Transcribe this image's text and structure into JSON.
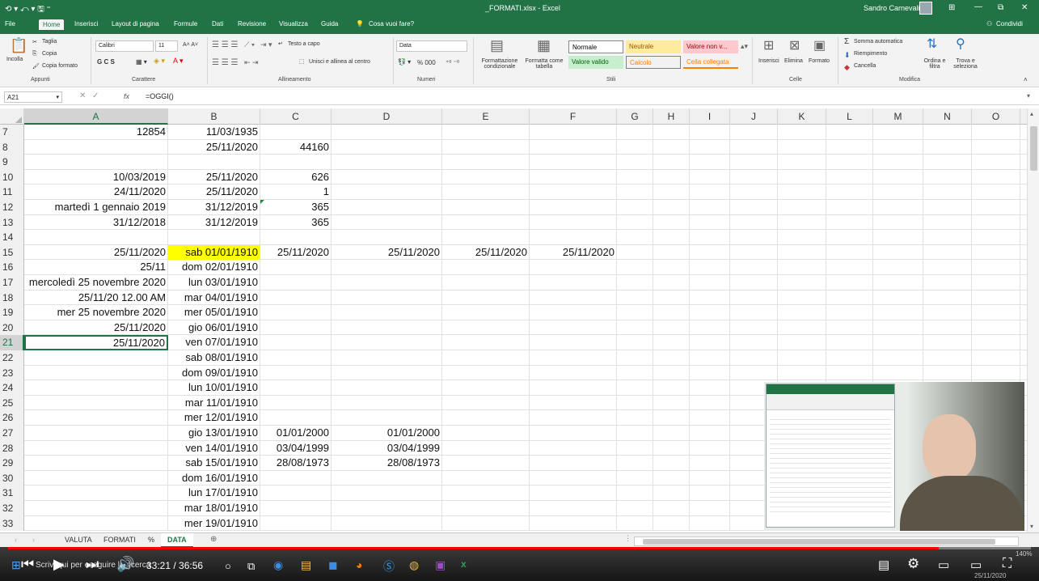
{
  "title": {
    "qat": "⟲ ▾ ⤺ ▾ 🖫 ⁼",
    "filename": "_FORMATI.xlsx - Excel",
    "user": "Sandro Carnevali",
    "controls": [
      "⊞",
      "—",
      "⧉",
      "✕"
    ]
  },
  "menu": {
    "tabs": [
      "File",
      "Home",
      "Inserisci",
      "Layout di pagina",
      "Formule",
      "Dati",
      "Revisione",
      "Visualizza",
      "Guida"
    ],
    "tellme": "Cosa vuoi fare?",
    "share": "Condividi"
  },
  "ribbon": {
    "clipboard": {
      "paste": "Incolla",
      "cut": "Taglia",
      "copy": "Copia",
      "format_painter": "Copia formato",
      "group": "Appunti"
    },
    "font": {
      "name": "Calibri",
      "size": "11",
      "grow": "A˄ A˅",
      "styles": "G C S",
      "group": "Carattere"
    },
    "alignment": {
      "wrap": "Testo a capo",
      "merge": "Unisci e allinea al centro",
      "group": "Allineamento"
    },
    "number": {
      "format": "Data",
      "symbols": "% 000",
      "group": "Numeri"
    },
    "styles": {
      "cond_format": "Formattazione condizionale",
      "format_table": "Formatta come tabella",
      "normal": "Normale",
      "neutral": "Neutrale",
      "bad": "Valore non v...",
      "good": "Valore valido",
      "calc": "Calcolo",
      "linked": "Cella collegata",
      "group": "Stili"
    },
    "cells": {
      "insert": "Inserisci",
      "delete": "Elimina",
      "format": "Formato",
      "group": "Celle"
    },
    "editing": {
      "autosum": "Somma automatica",
      "fill": "Riempimento",
      "clear": "Cancella",
      "sort": "Ordina e filtra",
      "find": "Trova e seleziona",
      "group": "Modifica"
    }
  },
  "formula_bar": {
    "name_box": "A21",
    "fx": "fx",
    "formula": "=OGGI()"
  },
  "columns": [
    "A",
    "B",
    "C",
    "D",
    "E",
    "F",
    "G",
    "H",
    "I",
    "J",
    "K",
    "L",
    "M",
    "N",
    "O"
  ],
  "rows": [
    {
      "n": "7",
      "cells": {
        "A": "12854",
        "B": "11/03/1935"
      }
    },
    {
      "n": "8",
      "cells": {
        "B": "25/11/2020",
        "C": "44160"
      }
    },
    {
      "n": "9",
      "cells": {}
    },
    {
      "n": "10",
      "cells": {
        "A": "10/03/2019",
        "B": "25/11/2020",
        "C": "626"
      }
    },
    {
      "n": "11",
      "cells": {
        "A": "24/11/2020",
        "B": "25/11/2020",
        "C": "1"
      }
    },
    {
      "n": "12",
      "cells": {
        "A": "martedì 1 gennaio 2019",
        "B": "31/12/2019",
        "C": "365"
      }
    },
    {
      "n": "13",
      "cells": {
        "A": "31/12/2018",
        "B": "31/12/2019",
        "C": "365"
      }
    },
    {
      "n": "14",
      "cells": {}
    },
    {
      "n": "15",
      "cells": {
        "A": "25/11/2020",
        "B": "sab 01/01/1910",
        "C": "25/11/2020",
        "D": "25/11/2020",
        "E": "25/11/2020",
        "F": "25/11/2020"
      }
    },
    {
      "n": "16",
      "cells": {
        "A": "25/11",
        "B": "dom 02/01/1910"
      }
    },
    {
      "n": "17",
      "cells": {
        "A": "mercoledì 25 novembre 2020",
        "B": "lun 03/01/1910"
      }
    },
    {
      "n": "18",
      "cells": {
        "A": "25/11/20 12.00 AM",
        "B": "mar 04/01/1910"
      }
    },
    {
      "n": "19",
      "cells": {
        "A": "mer 25 novembre 2020",
        "B": "mer 05/01/1910"
      }
    },
    {
      "n": "20",
      "cells": {
        "A": "25/11/2020",
        "B": "gio 06/01/1910"
      }
    },
    {
      "n": "21",
      "cells": {
        "A": "25/11/2020",
        "B": "ven 07/01/1910"
      }
    },
    {
      "n": "22",
      "cells": {
        "B": "sab 08/01/1910"
      }
    },
    {
      "n": "23",
      "cells": {
        "B": "dom 09/01/1910"
      }
    },
    {
      "n": "24",
      "cells": {
        "B": "lun 10/01/1910"
      }
    },
    {
      "n": "25",
      "cells": {
        "B": "mar 11/01/1910"
      }
    },
    {
      "n": "26",
      "cells": {
        "B": "mer 12/01/1910"
      }
    },
    {
      "n": "27",
      "cells": {
        "B": "gio 13/01/1910",
        "C": "01/01/2000",
        "D": "01/01/2000"
      }
    },
    {
      "n": "28",
      "cells": {
        "B": "ven 14/01/1910",
        "C": "03/04/1999",
        "D": "03/04/1999"
      }
    },
    {
      "n": "29",
      "cells": {
        "B": "sab 15/01/1910",
        "C": "28/08/1973",
        "D": "28/08/1973"
      }
    },
    {
      "n": "30",
      "cells": {
        "B": "dom 16/01/1910"
      }
    },
    {
      "n": "31",
      "cells": {
        "B": "lun 17/01/1910"
      }
    },
    {
      "n": "32",
      "cells": {
        "B": "mar 18/01/1910"
      }
    },
    {
      "n": "33",
      "cells": {
        "B": "mer 19/01/1910"
      }
    }
  ],
  "sheets": [
    "VALUTA",
    "FORMATI",
    "%",
    "DATA"
  ],
  "active_sheet": "DATA",
  "zoom": "140%",
  "video": {
    "time": "33:21 / 36:56",
    "progress_pct": 91
  },
  "taskbar": {
    "search": "Scrivi qui per eseguire la ricerca",
    "date": "25/11/2020"
  },
  "colors": {
    "excel_green": "#217346",
    "highlight": "#ffff00",
    "progress": "#ff0000"
  }
}
